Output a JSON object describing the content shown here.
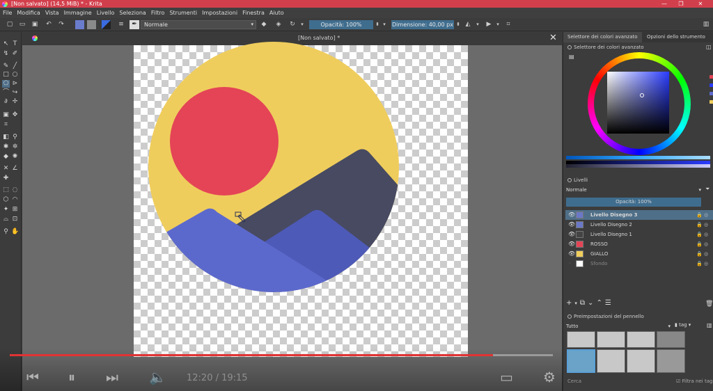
{
  "window": {
    "title": "[Non salvato]  (14,5 MiB)  * - Krita",
    "controls": [
      "—",
      "❐",
      "✕"
    ]
  },
  "menubar": [
    "File",
    "Modifica",
    "Vista",
    "Immagine",
    "Livello",
    "Seleziona",
    "Filtro",
    "Strumenti",
    "Impostazioni",
    "Finestra",
    "Aiuto"
  ],
  "toolbar": {
    "blend_mode": "Normale",
    "opacity_label": "Opacità: 100%",
    "size_label": "Dimensione: 40,00 px"
  },
  "document": {
    "tab_title": "[Non salvato]  *",
    "close_glyph": "✕"
  },
  "docker_tabs": [
    "Selettore dei colori avanzato",
    "Opzioni dello strumento"
  ],
  "color_selector": {
    "header": "Selettore dei colori avanzato",
    "accent_color": "#2a3cff"
  },
  "layers": {
    "header": "Livelli",
    "blend_mode": "Normale",
    "opacity_label": "Opacità:  100%",
    "items": [
      {
        "name": "Livello Disegno 3",
        "selected": true,
        "thumb": "#6a78c8"
      },
      {
        "name": "Livello Disegno 2",
        "selected": false,
        "thumb": "#6a78c8"
      },
      {
        "name": "Livello Disegno 1",
        "selected": false,
        "thumb": "#444"
      },
      {
        "name": "ROSSO",
        "selected": false,
        "thumb": "#e44456"
      },
      {
        "name": "GIALLO",
        "selected": false,
        "thumb": "#f0cd5c"
      },
      {
        "name": "Sfondo",
        "selected": false,
        "thumb": "#ffffff"
      }
    ]
  },
  "brush_presets": {
    "header": "Preimpostazioni del pennello",
    "filter": "Tutto",
    "tag_label": "tag",
    "search_label": "Cerca",
    "filter_tag_label": "Filtra nei tag"
  },
  "artwork_colors": {
    "yellow": "#efcd5d",
    "red": "#e44456",
    "dark": "#474a61",
    "blue_light": "#5c69cc",
    "blue_mid": "#4e5ab7"
  },
  "video": {
    "timecode": "12:20 / 19:15",
    "progress": 0.89
  }
}
